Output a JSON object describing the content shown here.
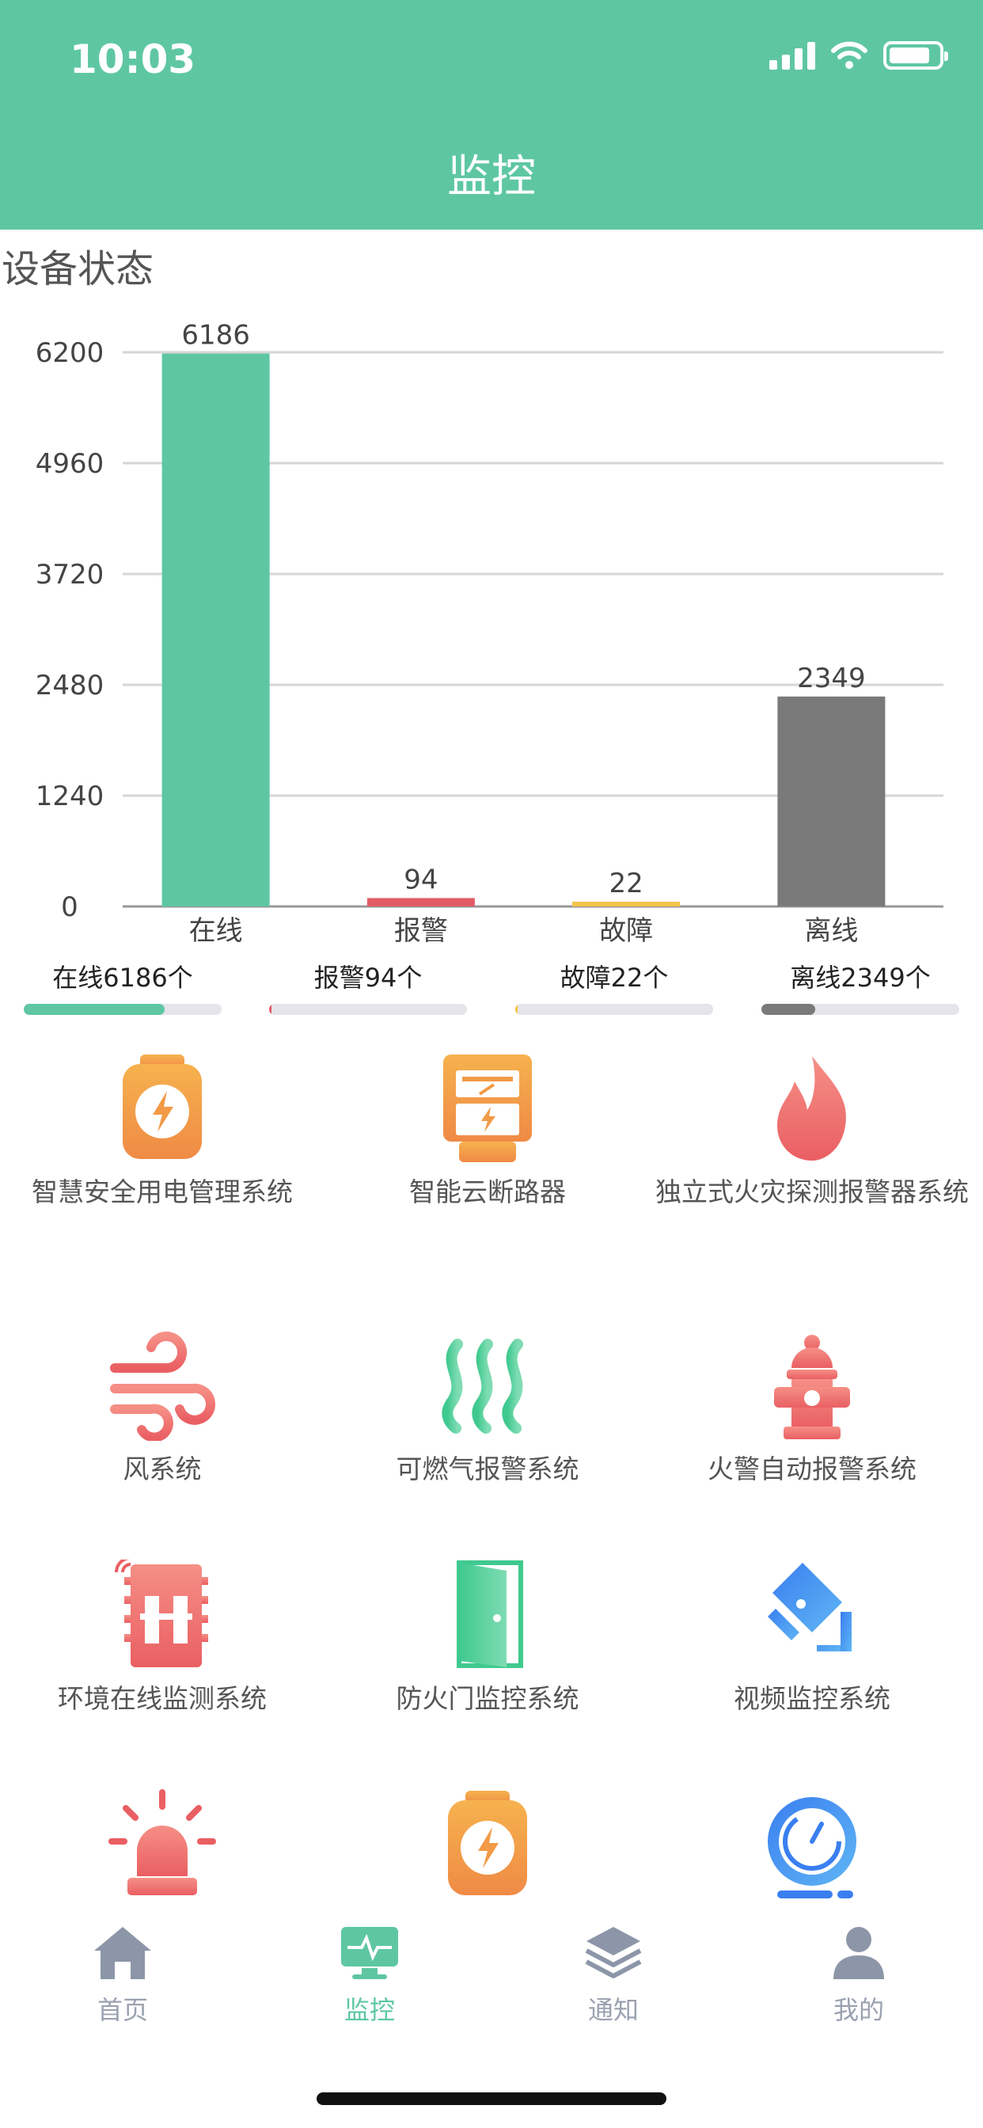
{
  "status_bar": {
    "time": "10:03"
  },
  "header": {
    "title": "监控"
  },
  "section": {
    "title": "设备状态"
  },
  "colors": {
    "online": "#5ec7a2",
    "alarm": "#e25b66",
    "fault": "#f4c44a",
    "offline": "#7a7a7a",
    "accent": "#5ec7a2"
  },
  "chart_data": {
    "type": "bar",
    "categories": [
      "在线",
      "报警",
      "故障",
      "离线"
    ],
    "values": [
      6186,
      94,
      22,
      2349
    ],
    "ylim": [
      0,
      6200
    ],
    "yticks": [
      0,
      1240,
      2480,
      3720,
      4960,
      6200
    ],
    "grid": true,
    "data_labels": true
  },
  "summary": [
    {
      "label": "在线6186个",
      "progress": 0.71
    },
    {
      "label": "报警94个",
      "progress": 0.011
    },
    {
      "label": "故障22个",
      "progress": 0.003
    },
    {
      "label": "离线2349个",
      "progress": 0.27
    }
  ],
  "systems": [
    {
      "label": "智慧安全用电管理系统",
      "icon": "electric-meter-icon"
    },
    {
      "label": "智能云断路器",
      "icon": "circuit-breaker-icon"
    },
    {
      "label": "独立式火灾探测报警器系统",
      "icon": "flame-icon"
    },
    {
      "label": "风系统",
      "icon": "wind-icon"
    },
    {
      "label": "可燃气报警系统",
      "icon": "gas-icon"
    },
    {
      "label": "火警自动报警系统",
      "icon": "fire-hydrant-icon"
    },
    {
      "label": "环境在线监测系统",
      "icon": "environment-monitor-icon"
    },
    {
      "label": "防火门监控系统",
      "icon": "fire-door-icon"
    },
    {
      "label": "视频监控系统",
      "icon": "camera-icon"
    },
    {
      "label": "",
      "icon": "alarm-light-icon"
    },
    {
      "label": "",
      "icon": "electric-meter-icon"
    },
    {
      "label": "",
      "icon": "pressure-gauge-icon"
    }
  ],
  "tabbar": [
    {
      "label": "首页",
      "icon": "home-icon",
      "active": false
    },
    {
      "label": "监控",
      "icon": "monitor-icon",
      "active": true
    },
    {
      "label": "通知",
      "icon": "layers-icon",
      "active": false
    },
    {
      "label": "我的",
      "icon": "user-icon",
      "active": false
    }
  ]
}
